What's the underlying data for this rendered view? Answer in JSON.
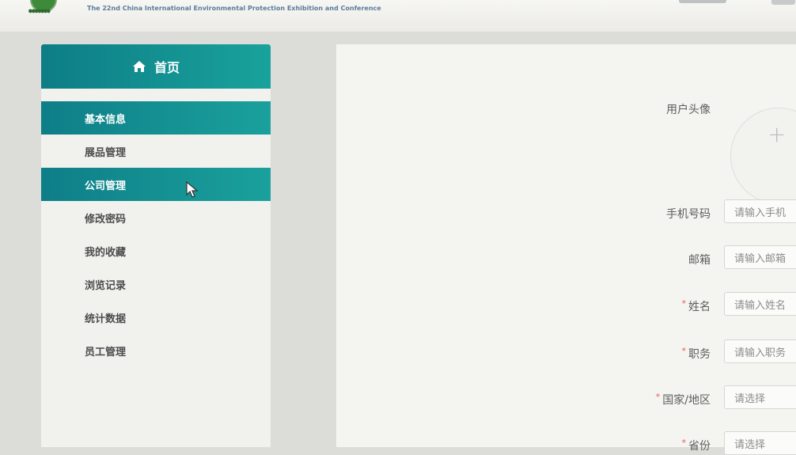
{
  "header": {
    "subtitle": "The 22nd China International Environmental Protection Exhibition and Conference",
    "logo_dots": "●●●●●●●"
  },
  "sidebar": {
    "home_label": "首页",
    "items": [
      {
        "label": "基本信息",
        "active": true
      },
      {
        "label": "展品管理",
        "active": false
      },
      {
        "label": "公司管理",
        "active": true
      },
      {
        "label": "修改密码",
        "active": false
      },
      {
        "label": "我的收藏",
        "active": false
      },
      {
        "label": "浏览记录",
        "active": false
      },
      {
        "label": "统计数据",
        "active": false
      },
      {
        "label": "员工管理",
        "active": false
      }
    ]
  },
  "form": {
    "avatar_label": "用户头像",
    "avatar_plus": "+",
    "phone_label": "手机号码",
    "phone_placeholder": "请输入手机",
    "email_label": "邮箱",
    "email_placeholder": "请输入邮箱",
    "name_label": "姓名",
    "name_placeholder": "请输入姓名",
    "position_label": "职务",
    "position_placeholder": "请输入职务",
    "country_label": "国家/地区",
    "country_value": "请选择",
    "province_label": "省份",
    "province_value": "请选择",
    "required_mark": "*"
  },
  "colors": {
    "accent": "#13918f",
    "required": "#e35d5d"
  }
}
